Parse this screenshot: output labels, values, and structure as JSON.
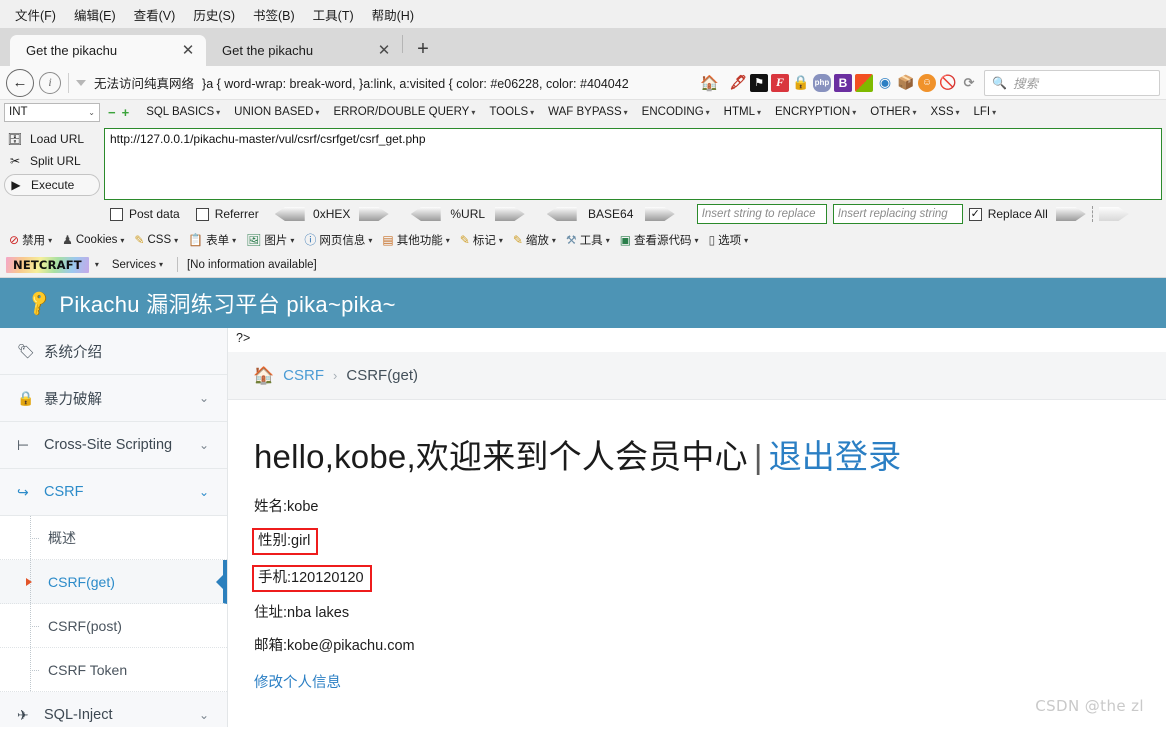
{
  "browser": {
    "menus": [
      {
        "label": "文件(F)",
        "key": "F"
      },
      {
        "label": "编辑(E)",
        "key": "E"
      },
      {
        "label": "查看(V)",
        "key": "V"
      },
      {
        "label": "历史(S)",
        "key": "S"
      },
      {
        "label": "书签(B)",
        "key": "B"
      },
      {
        "label": "工具(T)",
        "key": "T"
      },
      {
        "label": "帮助(H)",
        "key": "H"
      }
    ],
    "tabs": [
      {
        "title": "Get the pikachu",
        "active": true
      },
      {
        "title": "Get the pikachu",
        "active": false
      }
    ],
    "new_tab_label": "+",
    "urlbar": {
      "prefix_cn": "无法访问纯真网络",
      "text": "}a { word-wrap: break-word, }a:link, a:visited { color: #e06228, color: #404042",
      "home_icon": "home-icon"
    },
    "search": {
      "placeholder": "搜索"
    },
    "extension_icons": [
      "feather-icon",
      "flag-icon",
      "fireshot-icon",
      "lock-icon",
      "php-icon",
      "bootstrap-icon",
      "windows-icon",
      "jquery-icon",
      "box-icon",
      "smiley-icon",
      "noscript-icon",
      "reload-icon"
    ]
  },
  "hackbar": {
    "select_value": "INT",
    "minus_label": "−",
    "plus_label": "+",
    "menus": [
      "SQL BASICS",
      "UNION BASED",
      "ERROR/DOUBLE QUERY",
      "TOOLS",
      "WAF BYPASS",
      "ENCODING",
      "HTML",
      "ENCRYPTION",
      "OTHER",
      "XSS",
      "LFI"
    ],
    "actions": [
      {
        "label": "Load URL",
        "icon": "load-url-icon"
      },
      {
        "label": "Split URL",
        "icon": "split-url-icon"
      },
      {
        "label": "Execute",
        "icon": "execute-icon"
      }
    ],
    "url_value": "http://127.0.0.1/pikachu-master/vul/csrf/csrfget/csrf_get.php",
    "checkboxes": [
      {
        "label": "Post data",
        "checked": false
      },
      {
        "label": "Referrer",
        "checked": false
      }
    ],
    "encoders": [
      "0xHEX",
      "%URL",
      "BASE64"
    ],
    "replace_from_placeholder": "Insert string to replace",
    "replace_to_placeholder": "Insert replacing string",
    "replace_all": {
      "label": "Replace All",
      "checked": true,
      "mark": "☑"
    }
  },
  "webdev_toolbar": {
    "items": [
      {
        "label": "禁用",
        "icon": "disable-icon"
      },
      {
        "label": "Cookies",
        "icon": "cookies-icon"
      },
      {
        "label": "CSS",
        "icon": "css-icon"
      },
      {
        "label": "表单",
        "icon": "forms-icon"
      },
      {
        "label": "图片",
        "icon": "images-icon"
      },
      {
        "label": "网页信息",
        "icon": "info-icon"
      },
      {
        "label": "其他功能",
        "icon": "misc-icon"
      },
      {
        "label": "标记",
        "icon": "outline-icon"
      },
      {
        "label": "缩放",
        "icon": "resize-icon"
      },
      {
        "label": "工具",
        "icon": "tools-icon"
      },
      {
        "label": "查看源代码",
        "icon": "view-source-icon"
      },
      {
        "label": "选项",
        "icon": "options-icon"
      }
    ]
  },
  "netcraft_toolbar": {
    "logo": "NETCRAFT",
    "services_label": "Services",
    "status": "[No information available]"
  },
  "pikachu": {
    "header_title": "Pikachu 漏洞练习平台 pika~pika~",
    "header_icon": "key-icon",
    "header_bg": "#4d94b5",
    "accent_color": "#2c80bd",
    "php_fragment": "?>",
    "breadcrumb": {
      "home_icon": "home-icon",
      "items": [
        "CSRF"
      ],
      "separator": "›",
      "current": "CSRF(get)"
    },
    "sidebar": [
      {
        "label": "系统介绍",
        "icon": "tag-icon",
        "chevron": "",
        "open": false
      },
      {
        "label": "暴力破解",
        "icon": "lock-icon",
        "chevron": "⌄",
        "open": false
      },
      {
        "label": "Cross-Site Scripting",
        "icon": "xss-icon",
        "chevron": "⌄",
        "open": false
      },
      {
        "label": "CSRF",
        "icon": "csrf-icon",
        "chevron": "⌄",
        "open": true
      },
      {
        "label": "SQL-Inject",
        "icon": "sql-icon",
        "chevron": "⌄",
        "open": false
      }
    ],
    "sidebar_sub": [
      {
        "label": "概述",
        "active": false
      },
      {
        "label": "CSRF(get)",
        "active": true
      },
      {
        "label": "CSRF(post)",
        "active": false
      },
      {
        "label": "CSRF Token",
        "active": false
      }
    ],
    "welcome": {
      "greeting": "hello,kobe,欢迎来到个人会员中心",
      "divider": "|",
      "logout_label": "退出登录"
    },
    "profile": [
      {
        "label": "姓名:kobe",
        "boxed": false
      },
      {
        "label": "性别:girl",
        "boxed": true
      },
      {
        "label": "手机:120120120",
        "boxed": true
      },
      {
        "label": "住址:nba lakes",
        "boxed": false
      },
      {
        "label": "邮箱:kobe@pikachu.com",
        "boxed": false
      }
    ],
    "edit_link": "修改个人信息",
    "highlight_color": "#ee1c1c"
  },
  "watermark": "CSDN @the zl"
}
